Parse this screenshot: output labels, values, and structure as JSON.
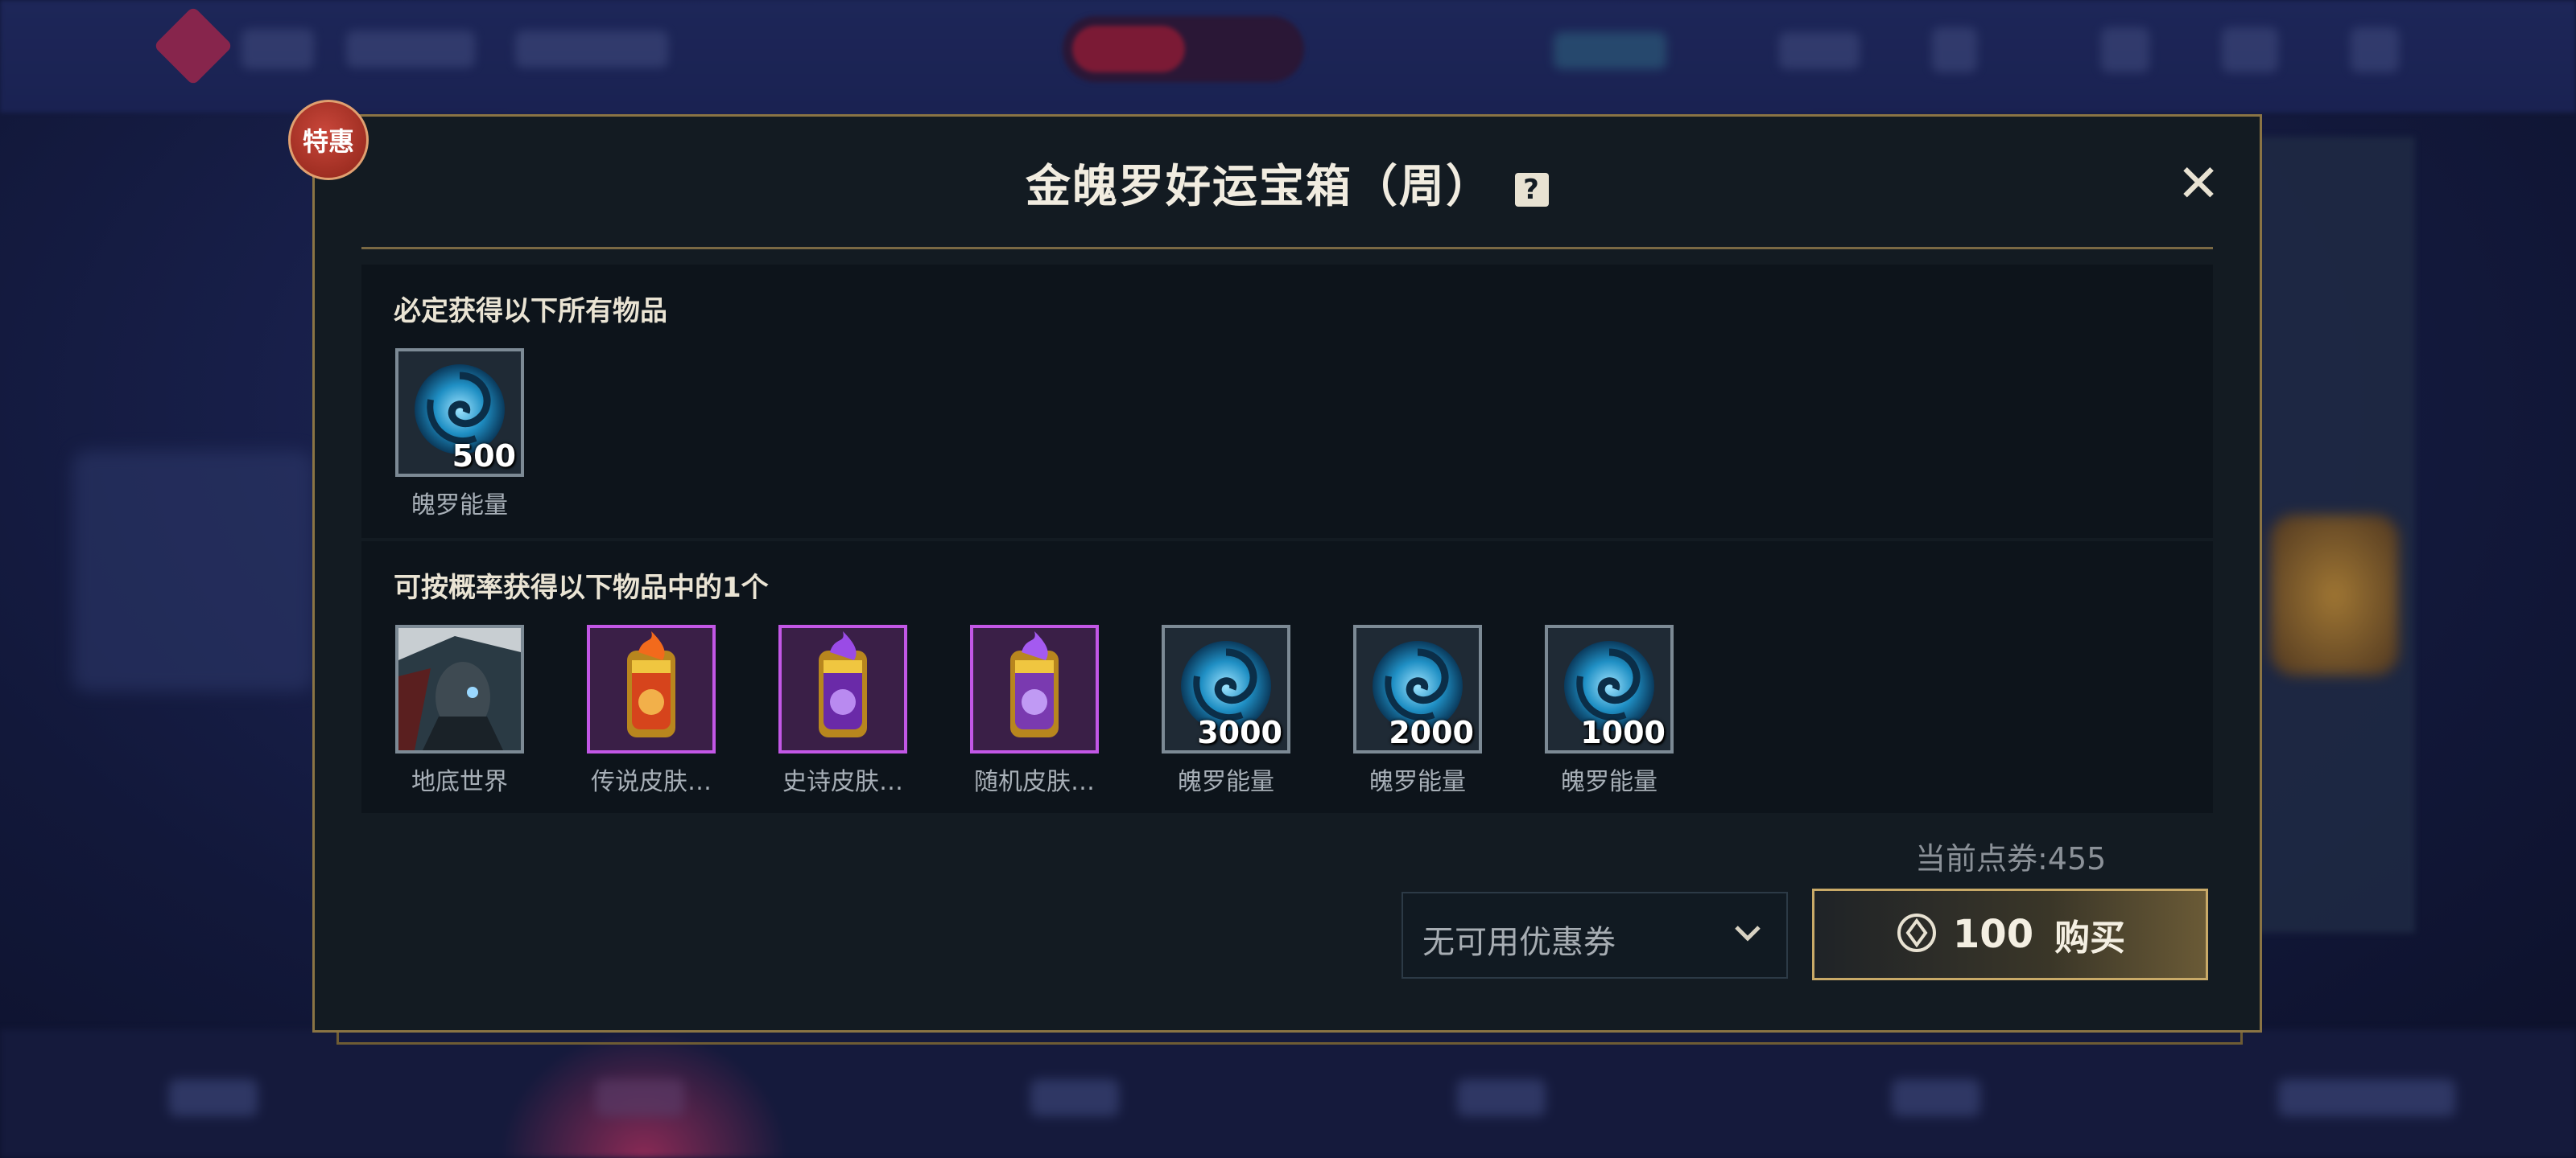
{
  "dialog": {
    "badge": "特惠",
    "title": "金魄罗好运宝箱（周）",
    "help_icon": "?",
    "close_icon": "✕"
  },
  "guaranteed": {
    "label": "必定获得以下所有物品",
    "items": [
      {
        "name": "魄罗能量",
        "qty": "500",
        "icon": "poro-energy-icon"
      }
    ]
  },
  "chance": {
    "label": "可按概率获得以下物品中的1个",
    "items": [
      {
        "name": "地底世界",
        "qty": "",
        "icon": "skin-portrait-icon"
      },
      {
        "name": "传说皮肤…",
        "qty": "",
        "icon": "legendary-skin-chest-icon"
      },
      {
        "name": "史诗皮肤…",
        "qty": "",
        "icon": "epic-skin-chest-icon"
      },
      {
        "name": "随机皮肤…",
        "qty": "",
        "icon": "random-skin-chest-icon"
      },
      {
        "name": "魄罗能量",
        "qty": "3000",
        "icon": "poro-energy-icon"
      },
      {
        "name": "魄罗能量",
        "qty": "2000",
        "icon": "poro-energy-icon"
      },
      {
        "name": "魄罗能量",
        "qty": "1000",
        "icon": "poro-energy-icon"
      }
    ]
  },
  "purchase": {
    "current_points_label": "当前点券:455",
    "coupon_select": "无可用优惠券",
    "price": "100",
    "buy_label": "购买"
  },
  "colors": {
    "gold_border": "#8a7444",
    "purple_rarity": "#c257e6",
    "badge_red": "#b8382c"
  }
}
